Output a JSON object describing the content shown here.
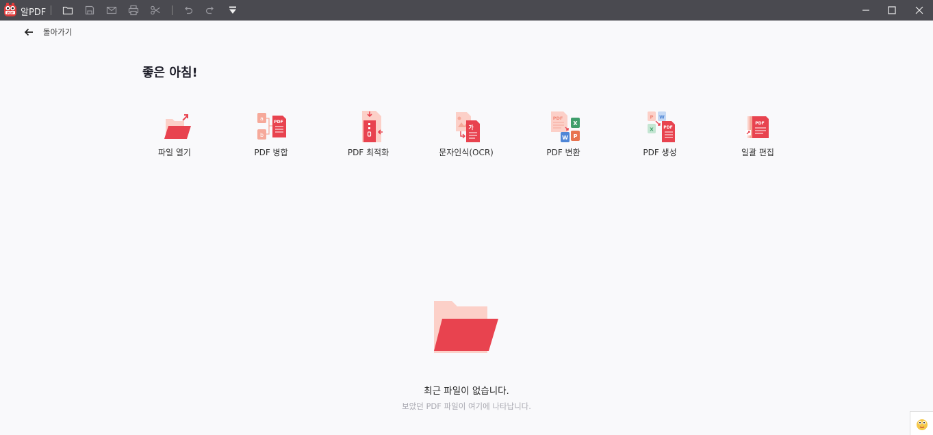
{
  "titlebar": {
    "app_name": "알PDF",
    "toolbar_icons": [
      "folder-icon",
      "save-icon",
      "mail-icon",
      "print-icon",
      "scissors-icon",
      "undo-icon",
      "redo-icon",
      "dropdown-menu-icon"
    ],
    "window_controls": [
      "minimize-icon",
      "maximize-icon",
      "close-icon"
    ]
  },
  "back": {
    "label": "돌아가기"
  },
  "greeting": "좋은 아침!",
  "tools": [
    {
      "label": "파일 열기",
      "icon": "open-file-icon"
    },
    {
      "label": "PDF 병합",
      "icon": "merge-pdf-icon"
    },
    {
      "label": "PDF 최적화",
      "icon": "optimize-pdf-icon"
    },
    {
      "label": "문자인식(OCR)",
      "icon": "ocr-icon"
    },
    {
      "label": "PDF 변환",
      "icon": "convert-pdf-icon"
    },
    {
      "label": "PDF 생성",
      "icon": "create-pdf-icon"
    },
    {
      "label": "일괄 편집",
      "icon": "batch-edit-icon"
    }
  ],
  "empty_state": {
    "title": "최근 파일이 없습니다.",
    "subtitle": "보았던 PDF 파일이 여기에 나타납니다."
  },
  "colors": {
    "titlebar_bg": "#4a4a50",
    "accent_red": "#e8434f",
    "accent_pink": "#fcd0c8",
    "page_bg": "#f9f9fb"
  }
}
